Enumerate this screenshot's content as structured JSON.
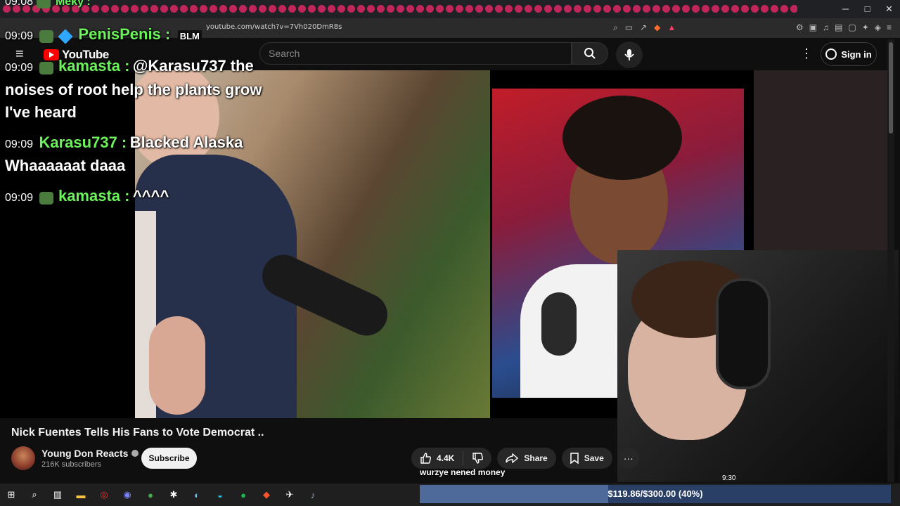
{
  "browser": {
    "url": "youtube.com/watch?v=7Vh020DmR8s",
    "window_controls": [
      "─",
      "□",
      "✕"
    ],
    "tab_count": 86
  },
  "youtube": {
    "logo_text": "YouTube",
    "search_placeholder": "Search",
    "sign_in_label": "Sign in"
  },
  "chat": {
    "top_line": {
      "time": "09:08",
      "user": "Meky :"
    },
    "lines": [
      {
        "time": "09:09",
        "user": "PenisPenis :",
        "msg": "",
        "badge": "BLM"
      },
      {
        "time": "09:09",
        "user": "kamasta :",
        "msg": "@Karasu737 the",
        "cont": [
          "noises of root help the plants grow",
          "I've heard"
        ]
      },
      {
        "time": "09:09",
        "user": "Karasu737 :",
        "msg": "Blacked Alaska",
        "cont": [
          "Whaaaaaat daaa"
        ]
      },
      {
        "time": "09:09",
        "user": "kamasta :",
        "msg": "^^^^"
      }
    ]
  },
  "video": {
    "title": "Nick Fuentes Tells His Fans to Vote Democrat ..",
    "channel_name": "Young Don Reacts",
    "subscribers": "216K subscribers",
    "subscribe_label": "Subscribe",
    "like_count": "4.4K",
    "share_label": "Share",
    "save_label": "Save",
    "more_label": "···"
  },
  "stream_overlay": {
    "donation_text": "wurzye nened money",
    "mini_time": "9:30",
    "goal_text": "$119.86/$300.00 (40%)",
    "goal_progress": 0.4
  },
  "taskbar": {
    "icons": [
      "start-icon",
      "search-icon",
      "task-view-icon",
      "file-explorer-icon",
      "app-icon",
      "discord-icon",
      "chrome-icon",
      "app2-icon",
      "steam-icon",
      "edge-icon",
      "spotify-icon",
      "brave-icon",
      "app3-icon",
      "volume-icon"
    ]
  },
  "colors": {
    "chat_username": "#6cf25a",
    "tab_accent": "#c0265a",
    "youtube_red": "#ff0000",
    "goal_fill": "#4e6a9a"
  }
}
